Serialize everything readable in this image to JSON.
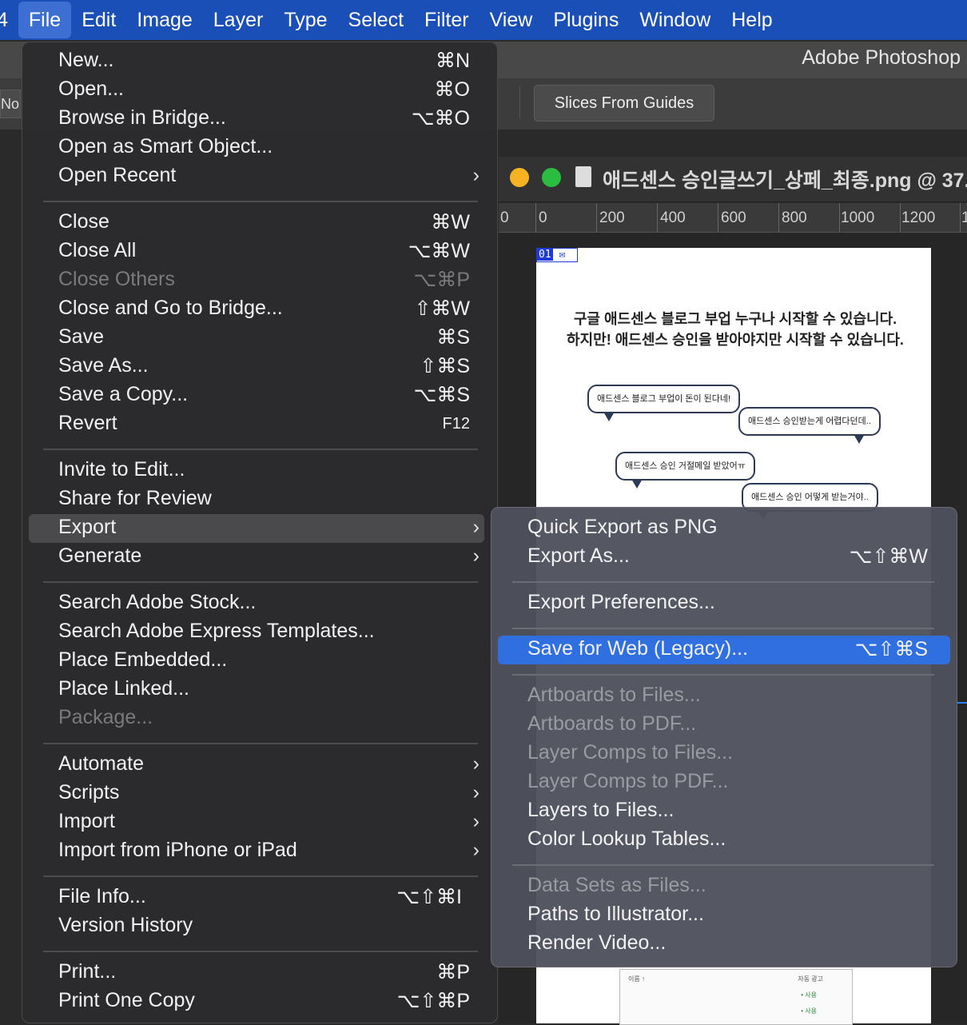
{
  "menubar": {
    "items": [
      "4",
      "File",
      "Edit",
      "Image",
      "Layer",
      "Type",
      "Select",
      "Filter",
      "View",
      "Plugins",
      "Window",
      "Help"
    ]
  },
  "app": {
    "title": "Adobe Photoshop",
    "left_fragment": "Nor",
    "slices_button": "Slices From Guides"
  },
  "document": {
    "tab_title": "애드센스 승인글쓰기_상페_최종.png @ 37.",
    "ruler_ticks": [
      "0",
      "0",
      "200",
      "400",
      "600",
      "800",
      "1000",
      "1200",
      "1"
    ],
    "slice_number": "01",
    "headline_line1": "구글 애드센스 블로그 부업 누구나 시작할 수 있습니다.",
    "headline_line2": "하지만! 애드센스 승인을 받아야지만 시작할 수 있습니다.",
    "bubbles": [
      "애드센스 블로그 부업이 돈이 된다네!",
      "애드센스 승인받는게 어렵다던데..",
      "애드센스 승인 거절메일 받았어ㅠ",
      "애드센스 승인 어떻게 받는거야.."
    ],
    "table_header_left": "이름 ↑",
    "table_header_right": "자동 광고",
    "table_values": [
      "• 사용",
      "• 사용"
    ]
  },
  "file_menu": {
    "groups": [
      [
        {
          "label": "New...",
          "shortcut": "⌘N"
        },
        {
          "label": "Open...",
          "shortcut": "⌘O"
        },
        {
          "label": "Browse in Bridge...",
          "shortcut": "⌥⌘O"
        },
        {
          "label": "Open as Smart Object...",
          "shortcut": ""
        },
        {
          "label": "Open Recent",
          "shortcut": "",
          "submenu": true
        }
      ],
      [
        {
          "label": "Close",
          "shortcut": "⌘W"
        },
        {
          "label": "Close All",
          "shortcut": "⌥⌘W"
        },
        {
          "label": "Close Others",
          "shortcut": "⌥⌘P",
          "disabled": true
        },
        {
          "label": "Close and Go to Bridge...",
          "shortcut": "⇧⌘W"
        },
        {
          "label": "Save",
          "shortcut": "⌘S"
        },
        {
          "label": "Save As...",
          "shortcut": "⇧⌘S"
        },
        {
          "label": "Save a Copy...",
          "shortcut": "⌥⌘S"
        },
        {
          "label": "Revert",
          "shortcut": "F12"
        }
      ],
      [
        {
          "label": "Invite to Edit...",
          "shortcut": ""
        },
        {
          "label": "Share for Review",
          "shortcut": ""
        },
        {
          "label": "Export",
          "shortcut": "",
          "submenu": true,
          "highlighted": true
        },
        {
          "label": "Generate",
          "shortcut": "",
          "submenu": true
        }
      ],
      [
        {
          "label": "Search Adobe Stock...",
          "shortcut": ""
        },
        {
          "label": "Search Adobe Express Templates...",
          "shortcut": ""
        },
        {
          "label": "Place Embedded...",
          "shortcut": ""
        },
        {
          "label": "Place Linked...",
          "shortcut": ""
        },
        {
          "label": "Package...",
          "shortcut": "",
          "disabled": true
        }
      ],
      [
        {
          "label": "Automate",
          "shortcut": "",
          "submenu": true
        },
        {
          "label": "Scripts",
          "shortcut": "",
          "submenu": true
        },
        {
          "label": "Import",
          "shortcut": "",
          "submenu": true
        },
        {
          "label": "Import from iPhone or iPad",
          "shortcut": "",
          "submenu": true
        }
      ],
      [
        {
          "label": "File Info...",
          "shortcut": "⌥⇧⌘I"
        },
        {
          "label": "Version History",
          "shortcut": ""
        }
      ],
      [
        {
          "label": "Print...",
          "shortcut": "⌘P"
        },
        {
          "label": "Print One Copy",
          "shortcut": "⌥⇧⌘P"
        }
      ]
    ]
  },
  "export_menu": {
    "groups": [
      [
        {
          "label": "Quick Export as PNG",
          "shortcut": ""
        },
        {
          "label": "Export As...",
          "shortcut": "⌥⇧⌘W"
        }
      ],
      [
        {
          "label": "Export Preferences...",
          "shortcut": ""
        }
      ],
      [
        {
          "label": "Save for Web (Legacy)...",
          "shortcut": "⌥⇧⌘S",
          "selected": true
        }
      ],
      [
        {
          "label": "Artboards to Files...",
          "shortcut": "",
          "disabled": true
        },
        {
          "label": "Artboards to PDF...",
          "shortcut": "",
          "disabled": true
        },
        {
          "label": "Layer Comps to Files...",
          "shortcut": "",
          "disabled": true
        },
        {
          "label": "Layer Comps to PDF...",
          "shortcut": "",
          "disabled": true
        },
        {
          "label": "Layers to Files...",
          "shortcut": ""
        },
        {
          "label": "Color Lookup Tables...",
          "shortcut": ""
        }
      ],
      [
        {
          "label": "Data Sets as Files...",
          "shortcut": "",
          "disabled": true
        },
        {
          "label": "Paths to Illustrator...",
          "shortcut": ""
        },
        {
          "label": "Render Video...",
          "shortcut": ""
        }
      ]
    ]
  },
  "colors": {
    "menubar": "#1b4fb8",
    "selection": "#2f6fe0",
    "disabled_text": "#7a7a7c"
  }
}
